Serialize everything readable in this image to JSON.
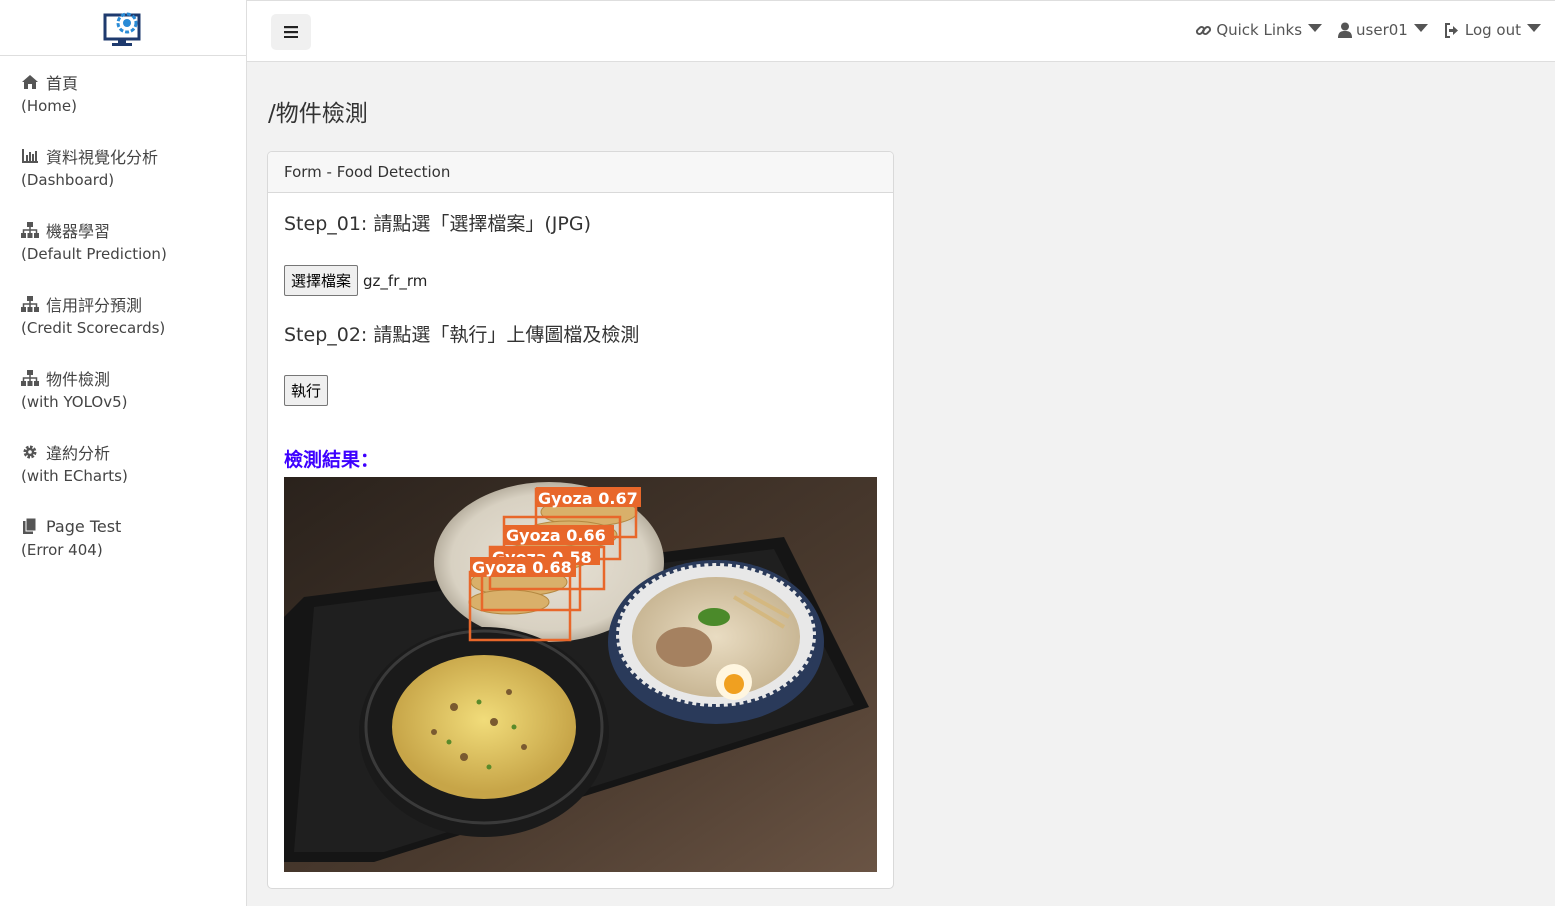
{
  "sidebar": {
    "items": [
      {
        "icon": "home-icon",
        "label": "首頁",
        "sub": "(Home)"
      },
      {
        "icon": "bar-chart-icon",
        "label": "資料視覺化分析",
        "sub": "(Dashboard)"
      },
      {
        "icon": "sitemap-icon",
        "label": "機器學習",
        "sub": "(Default Prediction)"
      },
      {
        "icon": "sitemap-icon",
        "label": "信用評分預測",
        "sub": "(Credit Scorecards)"
      },
      {
        "icon": "sitemap-icon",
        "label": "物件檢測",
        "sub": "(with YOLOv5)"
      },
      {
        "icon": "gear-icon",
        "label": "違約分析",
        "sub": "(with ECharts)"
      },
      {
        "icon": "copy-icon",
        "label": "Page Test",
        "sub": "(Error 404)"
      }
    ]
  },
  "topbar": {
    "quick_links": "Quick Links",
    "user": "user01",
    "logout": "Log out"
  },
  "page": {
    "title": "/物件檢測"
  },
  "card": {
    "header": "Form - Food Detection",
    "step1": "Step_01: 請點選「選擇檔案」(JPG)",
    "choose_file_button": "選擇檔案",
    "file_name": "gz_fr_rm",
    "step2": "Step_02: 請點選「執行」上傳圖檔及檢測",
    "run_button": "執行",
    "result_label": "檢測結果："
  },
  "detections": [
    {
      "label": "Gyoza 0.67"
    },
    {
      "label": "Gyoza 0.66"
    },
    {
      "label": "Gyoza 0.58"
    },
    {
      "label": "Gyoza 0.68"
    }
  ],
  "colors": {
    "accent": "#3d00ff",
    "box": "#e8672a"
  }
}
